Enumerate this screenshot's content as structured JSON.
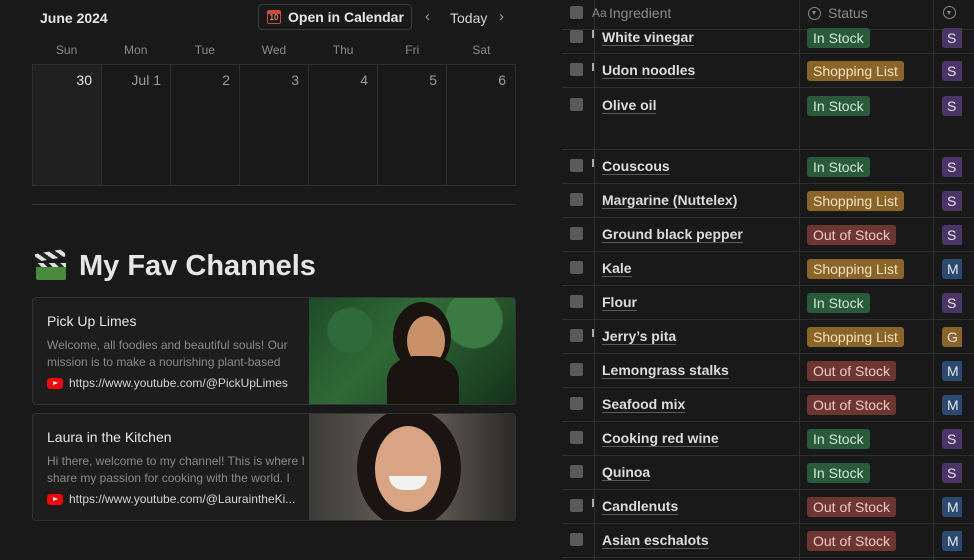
{
  "calendar": {
    "month_label": "June 2024",
    "open_button_label": "Open in Calendar",
    "open_button_icon": "calendar-icon",
    "open_button_icon_text": "10",
    "prev_icon": "‹",
    "today_label": "Today",
    "next_icon": "›",
    "weekdays": [
      "Sun",
      "Mon",
      "Tue",
      "Wed",
      "Thu",
      "Fri",
      "Sat"
    ],
    "days": [
      "30",
      "Jul 1",
      "2",
      "3",
      "4",
      "5",
      "6"
    ]
  },
  "channels": {
    "title": "My Fav Channels",
    "title_icon": "clapper-board-icon",
    "cards": [
      {
        "name": "Pick Up Limes",
        "description": "Welcome, all foodies and beautiful souls! Our mission is to make a nourishing plant-based",
        "url": "https://www.youtube.com/@PickUpLimes"
      },
      {
        "name": "Laura in the Kitchen",
        "description": "Hi there, welcome to my channel! This is where I share my passion for cooking with the world. I",
        "url": "https://www.youtube.com/@LauraintheKi..."
      }
    ]
  },
  "table": {
    "header_prefix": "Aa",
    "header_ingredient": "Ingredient",
    "header_status": "Status",
    "rows": [
      {
        "name": "White vinegar",
        "status": "In Stock",
        "extra": "S"
      },
      {
        "name": "Udon noodles",
        "status": "Shopping List",
        "extra": "S"
      },
      {
        "name": "Olive oil",
        "status": "In Stock",
        "extra": "S"
      },
      {
        "name": "Couscous",
        "status": "In Stock",
        "extra": "S"
      },
      {
        "name": "Margarine (Nuttelex)",
        "status": "Shopping List",
        "extra": "S"
      },
      {
        "name": "Ground black pepper",
        "status": "Out of Stock",
        "extra": "S"
      },
      {
        "name": "Kale",
        "status": "Shopping List",
        "extra": "M"
      },
      {
        "name": "Flour",
        "status": "In Stock",
        "extra": "S"
      },
      {
        "name": "Jerry’s pita",
        "status": "Shopping List",
        "extra": "G"
      },
      {
        "name": "Lemongrass stalks",
        "status": "Out of Stock",
        "extra": "M"
      },
      {
        "name": "Seafood mix",
        "status": "Out of Stock",
        "extra": "M"
      },
      {
        "name": "Cooking red wine",
        "status": "In Stock",
        "extra": "S"
      },
      {
        "name": "Quinoa",
        "status": "In Stock",
        "extra": "S"
      },
      {
        "name": "Candlenuts",
        "status": "Out of Stock",
        "extra": "M"
      },
      {
        "name": "Asian eschalots",
        "status": "Out of Stock",
        "extra": "M"
      }
    ]
  },
  "colors": {
    "in_stock_bg": "#2b5a3b",
    "shopping_bg": "#8a6428",
    "out_bg": "#6e3630",
    "extra_S_bg": "#4a3566",
    "extra_M_bg": "#2c4a70",
    "extra_G_bg": "#8a6428"
  }
}
